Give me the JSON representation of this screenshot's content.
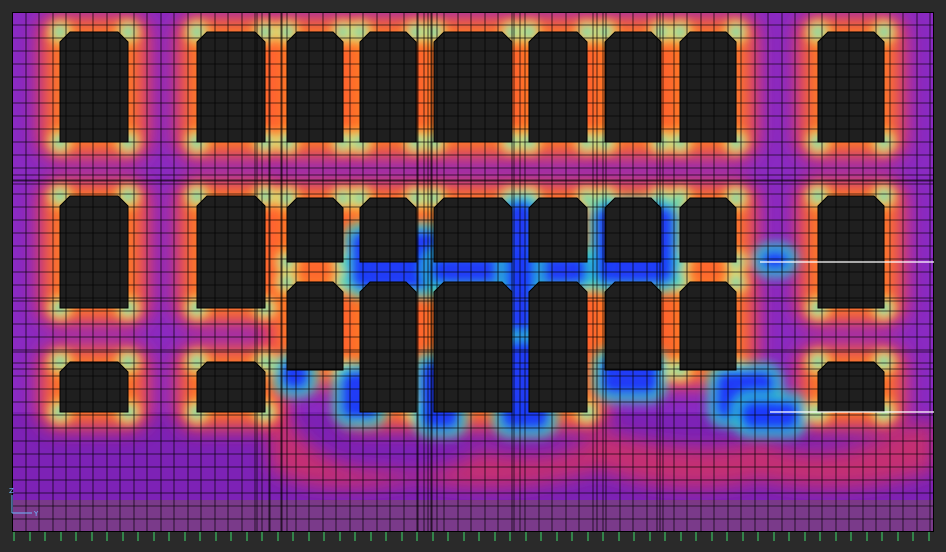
{
  "view": {
    "background_color": "#2a2a2a",
    "wall_base_color": "#8a2ac2",
    "opening_color": "#1f1f1f",
    "mesh_line_color": "#000000",
    "support_tick_color": "#3ddc6a",
    "section_line_color": "#ffffff"
  },
  "contour_palette": [
    "#ff3b3b",
    "#ff8c1a",
    "#ffe33a",
    "#9ad94a",
    "#2fd6c0",
    "#1e90ff",
    "#1a2cff",
    "#8a2ac2"
  ],
  "axis_triad": {
    "z_label": "Z",
    "y_label": "Y",
    "color": "#6fb7ff"
  }
}
